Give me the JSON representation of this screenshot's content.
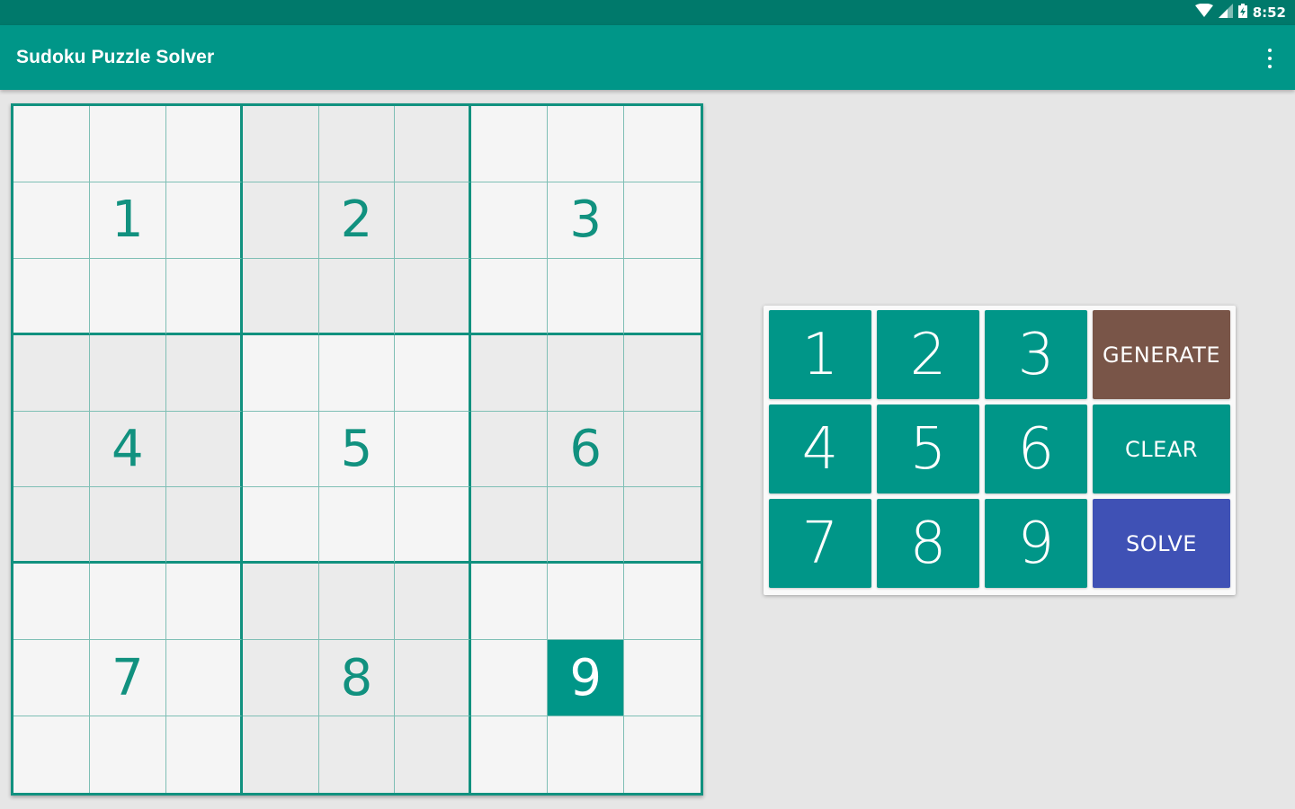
{
  "status_bar": {
    "time": "8:52",
    "icons": [
      "wifi-icon",
      "cell-signal-icon",
      "battery-charging-icon"
    ]
  },
  "app_bar": {
    "title": "Sudoku Puzzle Solver",
    "overflow_icon": "more-vert-icon"
  },
  "board": {
    "rows": [
      [
        "",
        "",
        "",
        "",
        "",
        "",
        "",
        "",
        ""
      ],
      [
        "",
        "1",
        "",
        "",
        "2",
        "",
        "",
        "3",
        ""
      ],
      [
        "",
        "",
        "",
        "",
        "",
        "",
        "",
        "",
        ""
      ],
      [
        "",
        "",
        "",
        "",
        "",
        "",
        "",
        "",
        ""
      ],
      [
        "",
        "4",
        "",
        "",
        "5",
        "",
        "",
        "6",
        ""
      ],
      [
        "",
        "",
        "",
        "",
        "",
        "",
        "",
        "",
        ""
      ],
      [
        "",
        "",
        "",
        "",
        "",
        "",
        "",
        "",
        ""
      ],
      [
        "",
        "7",
        "",
        "",
        "8",
        "",
        "",
        "9",
        ""
      ],
      [
        "",
        "",
        "",
        "",
        "",
        "",
        "",
        "",
        ""
      ]
    ],
    "selected_cell": {
      "row": 7,
      "col": 7
    }
  },
  "keypad": {
    "numbers": [
      "1",
      "2",
      "3",
      "4",
      "5",
      "6",
      "7",
      "8",
      "9"
    ],
    "generate_label": "GENERATE",
    "clear_label": "CLEAR",
    "solve_label": "SOLVE"
  },
  "colors": {
    "primary": "#009688",
    "primary_dark": "#00796b",
    "generate": "#795548",
    "solve": "#3f51b5"
  }
}
